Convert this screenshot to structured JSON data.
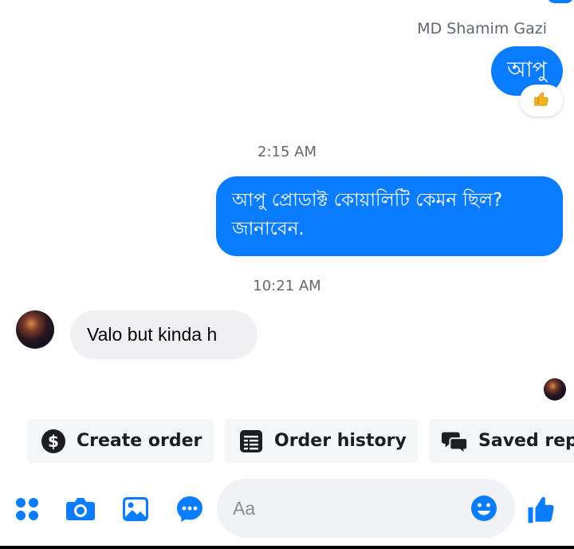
{
  "conversation": {
    "sender_name": "MD Shamim Gazi",
    "messages": [
      {
        "direction": "outgoing",
        "text": "আপু",
        "reaction": "thumbs-up"
      },
      {
        "timestamp": "2:15 AM"
      },
      {
        "direction": "outgoing",
        "text_line1": "আপু প্রোডাক্ট কোয়ালিটি কেমন ছিল?",
        "text_line2": "জানাবেন."
      },
      {
        "timestamp": "10:21 AM"
      },
      {
        "direction": "incoming",
        "text": "Valo but kinda h"
      }
    ]
  },
  "quick_replies": [
    {
      "label": "Create order",
      "icon": "dollar-icon"
    },
    {
      "label": "Order history",
      "icon": "list-icon"
    },
    {
      "label": "Saved rep",
      "icon": "chat-bubbles-icon"
    }
  ],
  "composer": {
    "placeholder": "Aa",
    "icons": [
      "menu-dots-icon",
      "camera-icon",
      "image-icon",
      "chat-more-icon",
      "emoji-icon",
      "like-icon"
    ]
  },
  "colors": {
    "accent": "#0a7cff",
    "incoming_bubble": "#f0f0f2",
    "chip_bg": "#f5f6f7"
  }
}
